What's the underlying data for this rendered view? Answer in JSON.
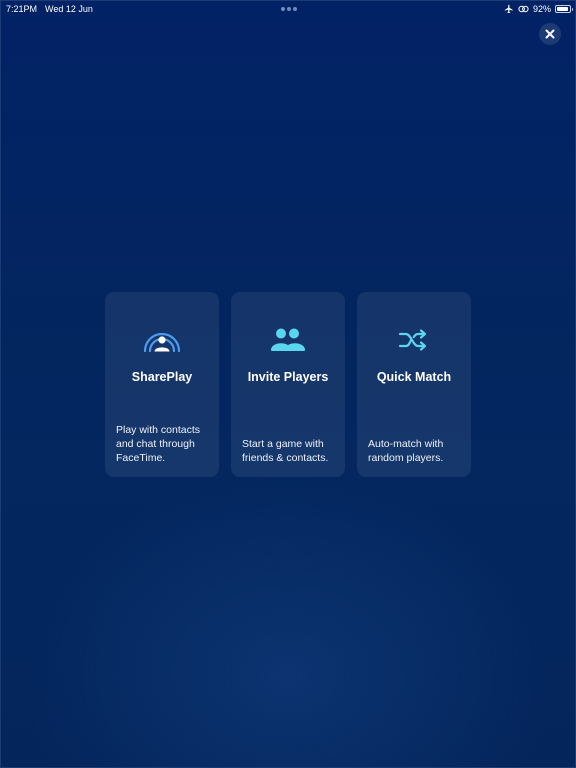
{
  "status": {
    "time": "7:21PM",
    "date": "Wed 12 Jun",
    "battery": "92%",
    "battery_level": 0.92
  },
  "icons": {
    "close": "close-icon",
    "airplane": "airplane-icon",
    "link": "link-icon",
    "shareplay": "shareplay-icon",
    "invite": "people-icon",
    "quick_match": "shuffle-icon"
  },
  "colors": {
    "background": "#032460",
    "accent_blue": "#4d9cf0",
    "accent_cyan": "#5bd6f0",
    "card": "#16356a"
  },
  "cards": [
    {
      "title": "SharePlay",
      "description": "Play with contacts and chat through FaceTime."
    },
    {
      "title": "Invite Players",
      "description": "Start a game with friends & contacts."
    },
    {
      "title": "Quick Match",
      "description": "Auto-match with random players."
    }
  ]
}
